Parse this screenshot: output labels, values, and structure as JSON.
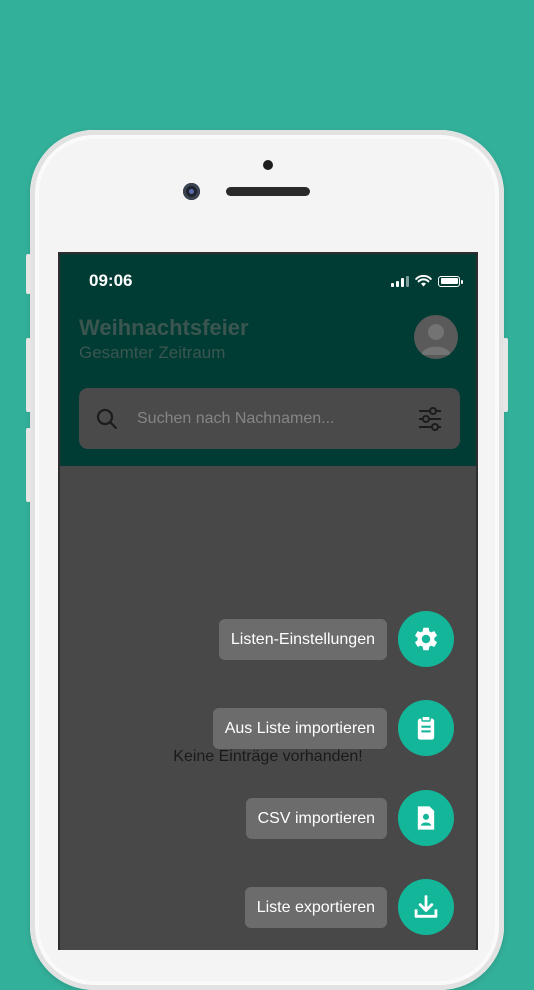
{
  "colors": {
    "background": "#33b09a",
    "header": "#003c33",
    "accent": "#14b69a",
    "overlay": "#484848"
  },
  "status_bar": {
    "time": "09:06",
    "icons": [
      "signal-icon",
      "wifi-icon",
      "battery-icon"
    ]
  },
  "header": {
    "title": "Weihnachtsfeier",
    "subtitle": "Gesamter Zeitraum",
    "avatar_icon": "user-avatar-icon"
  },
  "search": {
    "placeholder": "Suchen nach Nachnamen...",
    "value": "",
    "icon": "search-icon",
    "filter_icon": "filter-sliders-icon"
  },
  "empty_message": "Keine Einträge vorhanden!",
  "speed_dial": [
    {
      "label": "Listen-Einstellungen",
      "icon": "gear-icon"
    },
    {
      "label": "Aus Liste importieren",
      "icon": "clipboard-icon"
    },
    {
      "label": "CSV importieren",
      "icon": "contact-file-icon"
    },
    {
      "label": "Liste exportieren",
      "icon": "download-icon"
    }
  ]
}
